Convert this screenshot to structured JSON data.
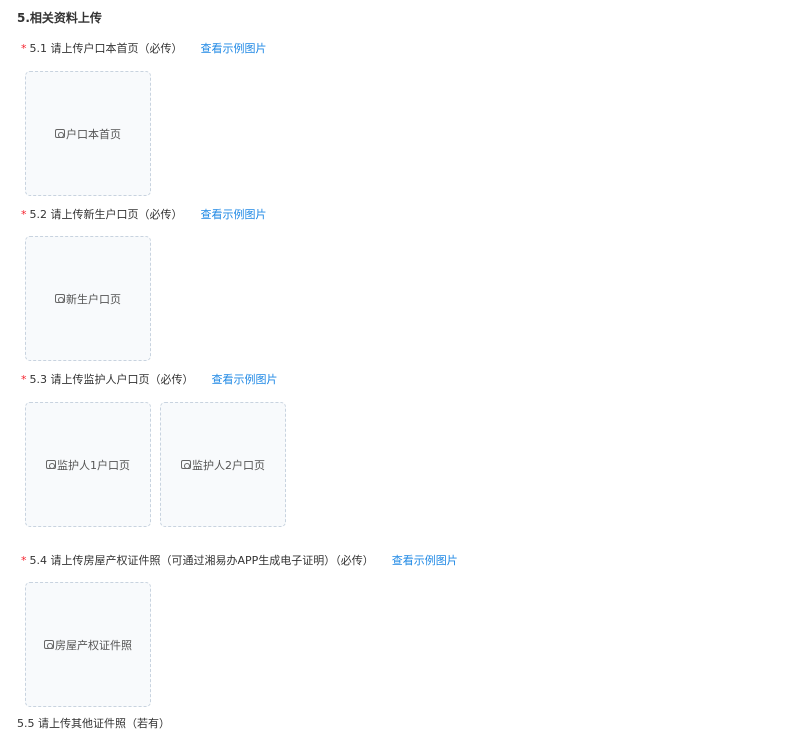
{
  "section_title": "5.相关资料上传",
  "example_link": "查看示例图片",
  "fields": [
    {
      "label": "5.1 请上传户口本首页（必传）",
      "required": true,
      "uploads": [
        "户口本首页"
      ]
    },
    {
      "label": "5.2 请上传新生户口页（必传）",
      "required": true,
      "uploads": [
        "新生户口页"
      ]
    },
    {
      "label": "5.3 请上传监护人户口页（必传）",
      "required": true,
      "uploads": [
        "监护人1户口页",
        "监护人2户口页"
      ]
    },
    {
      "label": "5.4 请上传房屋产权证件照（可通过湘易办APP生成电子证明）（必传）",
      "required": true,
      "uploads": [
        "房屋产权证件照"
      ]
    },
    {
      "label": "5.5 请上传其他证件照（若有）",
      "required": false,
      "uploads": []
    }
  ],
  "required_mark": "*",
  "colors": {
    "required": "#f5222d",
    "link": "#1e88e5",
    "box_border": "#c8d3df"
  }
}
